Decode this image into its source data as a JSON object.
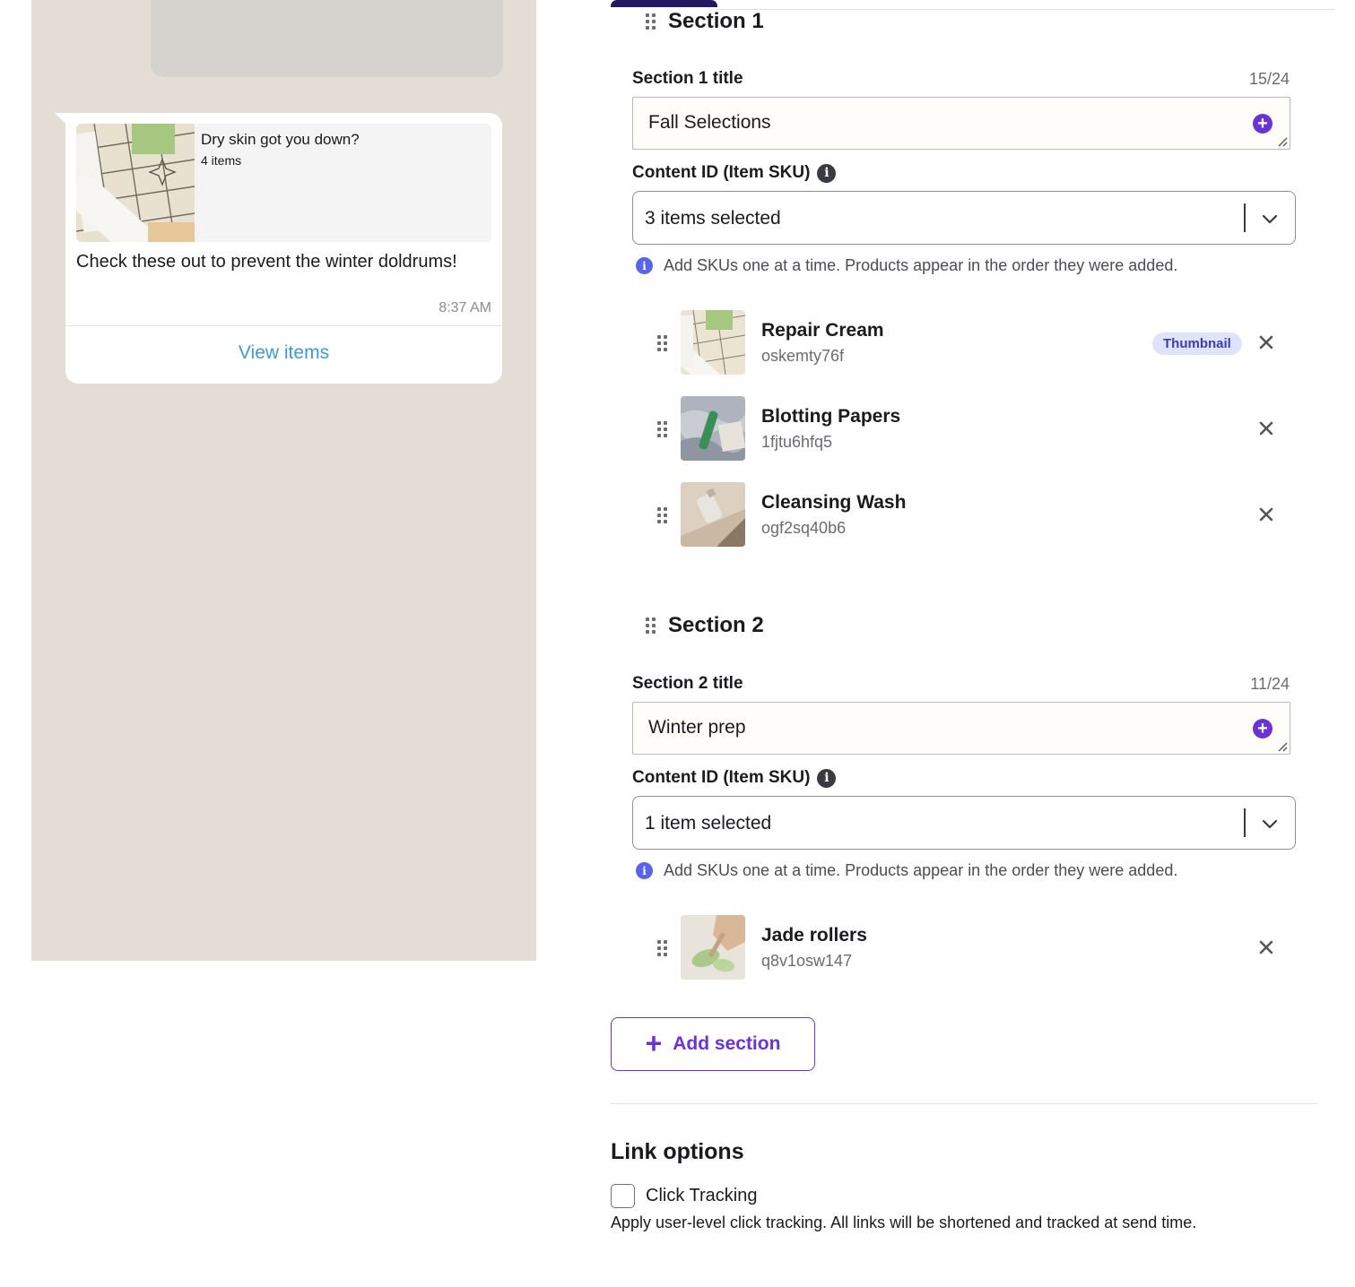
{
  "preview": {
    "catalog_title": "Dry skin got you down?",
    "catalog_count": "4 items",
    "message_text": "Check these out to prevent the winter doldrums!",
    "timestamp": "8:37 AM",
    "action_label": "View items"
  },
  "sections": [
    {
      "heading": "Section 1",
      "title_label": "Section 1 title",
      "title_count": "15/24",
      "title_value": "Fall Selections",
      "content_id_label": "Content ID (Item SKU)",
      "select_value": "3 items selected",
      "hint": "Add SKUs one at a time. Products appear in the order they were added.",
      "items": [
        {
          "name": "Repair Cream",
          "sku": "oskemty76f",
          "badge": "Thumbnail"
        },
        {
          "name": "Blotting Papers",
          "sku": "1fjtu6hfq5"
        },
        {
          "name": "Cleansing Wash",
          "sku": "ogf2sq40b6"
        }
      ]
    },
    {
      "heading": "Section 2",
      "title_label": "Section 2 title",
      "title_count": "11/24",
      "title_value": "Winter prep",
      "content_id_label": "Content ID (Item SKU)",
      "select_value": "1 item selected",
      "hint": "Add SKUs one at a time. Products appear in the order they were added.",
      "items": [
        {
          "name": "Jade rollers",
          "sku": "q8v1osw147"
        }
      ]
    }
  ],
  "add_section_label": "Add section",
  "link_options": {
    "title": "Link options",
    "click_tracking_label": "Click Tracking",
    "click_tracking_checked": false,
    "click_tracking_help": "Apply user-level click tracking. All links will be shortened and tracked at send time."
  },
  "icons": {
    "drag": "drag-handle-icon",
    "info": "info-icon",
    "add": "add-circle-icon",
    "chevron": "chevron-down-icon",
    "remove": "close-icon"
  },
  "colors": {
    "accent": "#6b32d9",
    "link": "#3c9bd6",
    "preview_bg": "#e3ddd6",
    "badge_bg": "#dfe3fb"
  }
}
